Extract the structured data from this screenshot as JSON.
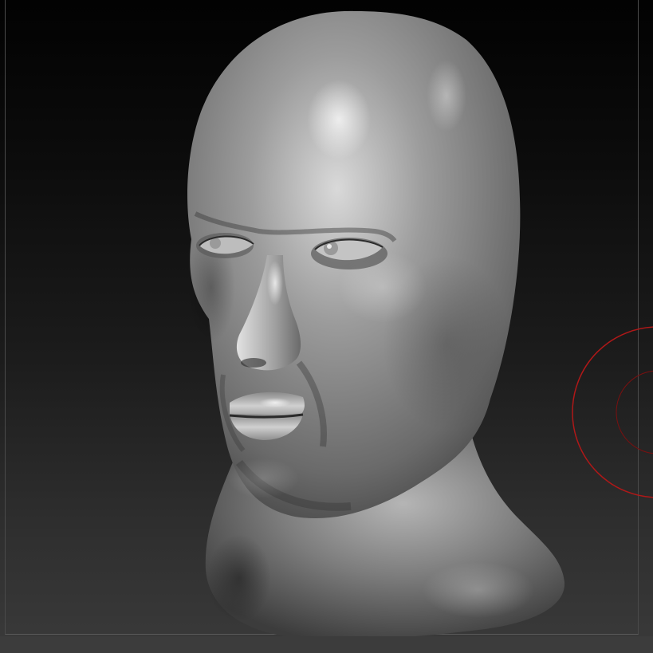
{
  "canvas": {
    "background_top": "#020202",
    "background_bottom": "#3a3a3a",
    "frame_color": "#4a4a4a"
  },
  "model": {
    "material_base": "#8a8a8a",
    "material_highlight": "#d8d8d8",
    "material_shadow": "#2a2a2a"
  },
  "brush_cursor": {
    "color": "#b01818",
    "icon": "brush-ring-icon"
  }
}
